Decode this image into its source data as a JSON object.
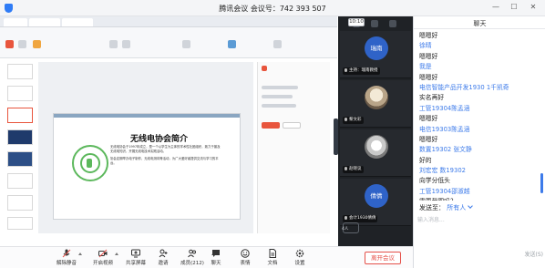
{
  "window": {
    "title": "腾讯会议  会议号：742 393 507",
    "controls": [
      "minimize-icon",
      "maximize-icon",
      "close-icon"
    ]
  },
  "chat": {
    "title": "聊天",
    "lines": [
      {
        "kind": "text",
        "text": "嗯嗯好"
      },
      {
        "kind": "name",
        "text": "徐晴"
      },
      {
        "kind": "text",
        "text": "嗯嗯好"
      },
      {
        "kind": "name",
        "text": "我是"
      },
      {
        "kind": "text",
        "text": "嗯嗯好"
      },
      {
        "kind": "name",
        "text": "电信智能产品开发1930 1千凯奇"
      },
      {
        "kind": "text",
        "text": "实名再好"
      },
      {
        "kind": "name",
        "text": "工管19304陈孟涵"
      },
      {
        "kind": "text",
        "text": "嗯嗯好"
      },
      {
        "kind": "name",
        "text": "电信19303陈孟涵"
      },
      {
        "kind": "text",
        "text": "嗯嗯好"
      },
      {
        "kind": "name",
        "text": "数置19302 张文静"
      },
      {
        "kind": "text",
        "text": "好的"
      },
      {
        "kind": "name",
        "text": "刘宏宏 数19302"
      },
      {
        "kind": "text",
        "text": "向学分低头"
      },
      {
        "kind": "name",
        "text": "工管19304邵淑越"
      },
      {
        "kind": "text",
        "text": "需要截图吗？"
      }
    ],
    "send_label": "发送至",
    "send_target": "所有人",
    "input_placeholder": "输入消息...",
    "send_button": "发送(S)",
    "clock": "10:10"
  },
  "participants": [
    {
      "avatar_text": "瑞南",
      "tag": "主持：瑞南教授",
      "avatar_style": "blue"
    },
    {
      "avatar_text": "",
      "tag": "黎文彩",
      "avatar_style": "photo"
    },
    {
      "avatar_text": "",
      "tag": "赵晓议",
      "avatar_style": "photo2"
    },
    {
      "avatar_text": "倩倩",
      "tag": "会计1930倩倩",
      "avatar_style": "blue"
    },
    {
      "avatar_text": "",
      "tag": "",
      "avatar_style": "dark"
    }
  ],
  "people_count": "4人",
  "toolbar": [
    {
      "label": "解除静音",
      "icon": "microphone-icon"
    },
    {
      "label": "开启视频",
      "icon": "camera-icon"
    },
    {
      "label": "共享屏幕",
      "icon": "screen-share-icon"
    },
    {
      "label": "邀请",
      "icon": "invite-icon"
    },
    {
      "label": "成员(212)",
      "icon": "members-icon"
    },
    {
      "label": "聊天",
      "icon": "chat-icon"
    },
    {
      "label": "表情",
      "icon": "emoji-icon"
    },
    {
      "label": "文档",
      "icon": "document-icon"
    },
    {
      "label": "设置",
      "icon": "settings-icon"
    }
  ],
  "leave_button": "离开会议",
  "shared_slide": {
    "title": "无线电协会简介",
    "paragraphs": [
      "无线电协会于1997年成立，是一个以学生为主体的学术性社团组织，致力于普及无线电知识，开展无线电技术实践活动。",
      "协会定期举办电子制作、无线电测向等活动，为广大爱好者提供交流与学习的平台。"
    ]
  },
  "colors": {
    "accent": "#3d7bea",
    "leave": "#e5514a",
    "video_bg": "#1f2226",
    "avatar_blue": "#2f63c8",
    "logo_green": "#5cb85c"
  }
}
